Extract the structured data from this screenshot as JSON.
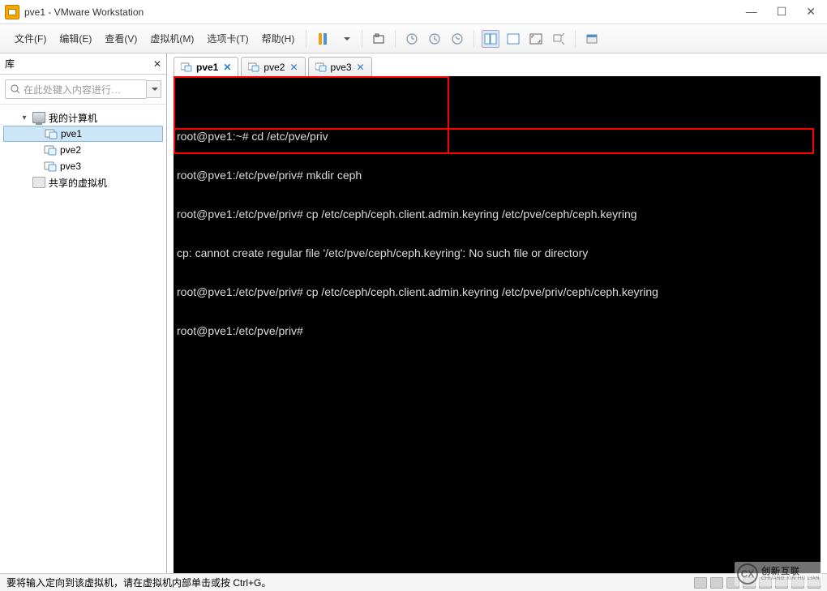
{
  "titlebar": {
    "title": "pve1 - VMware Workstation"
  },
  "menu": {
    "file": "文件(F)",
    "edit": "编辑(E)",
    "view": "查看(V)",
    "vm": "虚拟机(M)",
    "tabs": "选项卡(T)",
    "help": "帮助(H)"
  },
  "sidebar": {
    "panel_title": "库",
    "search_placeholder": "在此处键入内容进行…",
    "root": "我的计算机",
    "nodes": [
      {
        "label": "pve1",
        "selected": true
      },
      {
        "label": "pve2",
        "selected": false
      },
      {
        "label": "pve3",
        "selected": false
      }
    ],
    "shared": "共享的虚拟机"
  },
  "tabs": [
    {
      "label": "pve1",
      "active": true
    },
    {
      "label": "pve2",
      "active": false
    },
    {
      "label": "pve3",
      "active": false
    }
  ],
  "terminal": {
    "lines": [
      "root@pve1:~# cd /etc/pve/priv",
      "root@pve1:/etc/pve/priv# mkdir ceph",
      "root@pve1:/etc/pve/priv# cp /etc/ceph/ceph.client.admin.keyring /etc/pve/ceph/ceph.keyring",
      "cp: cannot create regular file '/etc/pve/ceph/ceph.keyring': No such file or directory",
      "root@pve1:/etc/pve/priv# cp /etc/ceph/ceph.client.admin.keyring /etc/pve/priv/ceph/ceph.keyring",
      "root@pve1:/etc/pve/priv# "
    ]
  },
  "status": {
    "text": "要将输入定向到该虚拟机，请在虚拟机内部单击或按 Ctrl+G。"
  },
  "watermark": {
    "line1": "创新互联",
    "line2": "CHUANG XIN HU LIAN",
    "badge": "CX"
  }
}
